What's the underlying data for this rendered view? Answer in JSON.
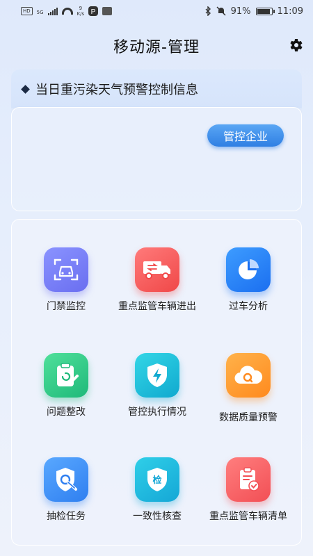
{
  "status_bar": {
    "hd": "HD",
    "network": "5G",
    "speed_value": "9",
    "speed_unit": "K/s",
    "battery_percent": "91%",
    "battery_level": 0.91,
    "time": "11:09"
  },
  "header": {
    "title": "移动源-管理",
    "settings_icon": "gear-icon"
  },
  "warning": {
    "title": "当日重污染天气预警控制信息",
    "control_button": "管控企业"
  },
  "functions": [
    {
      "label": "门禁监控",
      "icon": "car-scan-icon",
      "color": "#7078f5"
    },
    {
      "label": "重点监管车辆进出",
      "icon": "truck-icon",
      "color": "#f25252"
    },
    {
      "label": "过车分析",
      "icon": "pie-chart-icon",
      "color": "#2378f2"
    },
    {
      "label": "问题整改",
      "icon": "clipboard-edit-icon",
      "color": "#25c183"
    },
    {
      "label": "管控执行情况",
      "icon": "shield-bolt-icon",
      "color": "#16b2d4"
    },
    {
      "label": "数据质量预警",
      "icon": "cloud-q-icon",
      "color": "#ff9128"
    },
    {
      "label": "抽检任务",
      "icon": "shield-search-icon",
      "color": "#3a88f3"
    },
    {
      "label": "一致性核查",
      "icon": "inspect-badge-icon",
      "color": "#1aaedb"
    },
    {
      "label": "重点监管车辆清单",
      "icon": "checklist-icon",
      "color": "#f4575c"
    }
  ],
  "colors": {
    "accent": "#2f7fe3",
    "background": "#e3ecfb"
  }
}
